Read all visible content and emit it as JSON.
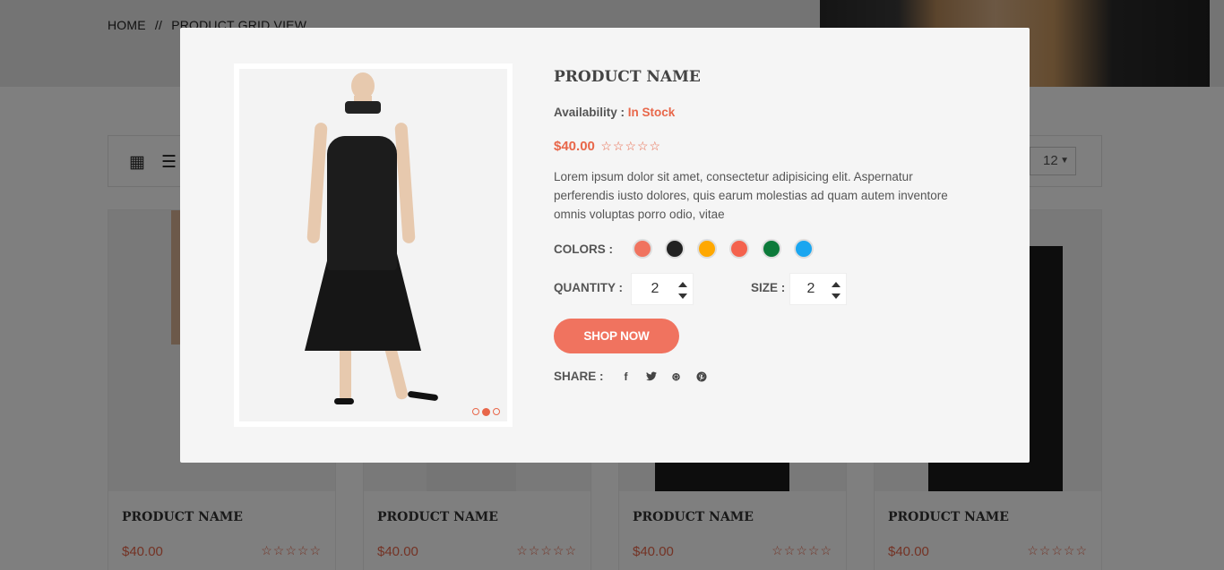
{
  "breadcrumb": {
    "home": "HOME",
    "separator": "//",
    "current": "PRODUCT GRID VIEW"
  },
  "toolbar": {
    "show_value": "12",
    "grid_icon": "grid-view-icon",
    "list_icon": "list-view-icon"
  },
  "cards": [
    {
      "name": "PRODUCT NAME",
      "price": "$40.00",
      "stars": "☆☆☆☆☆"
    },
    {
      "name": "PRODUCT NAME",
      "price": "$40.00",
      "stars": "☆☆☆☆☆"
    },
    {
      "name": "PRODUCT NAME",
      "price": "$40.00",
      "stars": "☆☆☆☆☆"
    },
    {
      "name": "PRODUCT NAME",
      "price": "$40.00",
      "stars": "☆☆☆☆☆"
    }
  ],
  "modal": {
    "title": "PRODUCT NAME",
    "availability_label": "Availability :",
    "availability_value": "In Stock",
    "price": "$40.00",
    "stars": "☆☆☆☆☆",
    "rating": 0,
    "description": "Lorem ipsum dolor sit amet, consectetur adipisicing elit. Aspernatur perferendis iusto dolores, quis earum molestias ad quam autem inventore omnis voluptas porro odio, vitae",
    "colors_label": "COLORS :",
    "colors": [
      "#f0735f",
      "#222222",
      "#ffa800",
      "#f4624d",
      "#0c7a3a",
      "#1aa6f0"
    ],
    "quantity_label": "QUANTITY :",
    "quantity_value": "2",
    "size_label": "SIZE :",
    "size_value": "2",
    "shop_button": "SHOP NOW",
    "share_label": "SHARE :",
    "share_icons": [
      "facebook-icon",
      "twitter-icon",
      "dribbble-icon",
      "pinterest-icon"
    ],
    "share_glyphs": [
      "f",
      "🐦",
      "⊛",
      "℗"
    ],
    "gallery_active_slide": 2,
    "gallery_slide_count": 3
  }
}
